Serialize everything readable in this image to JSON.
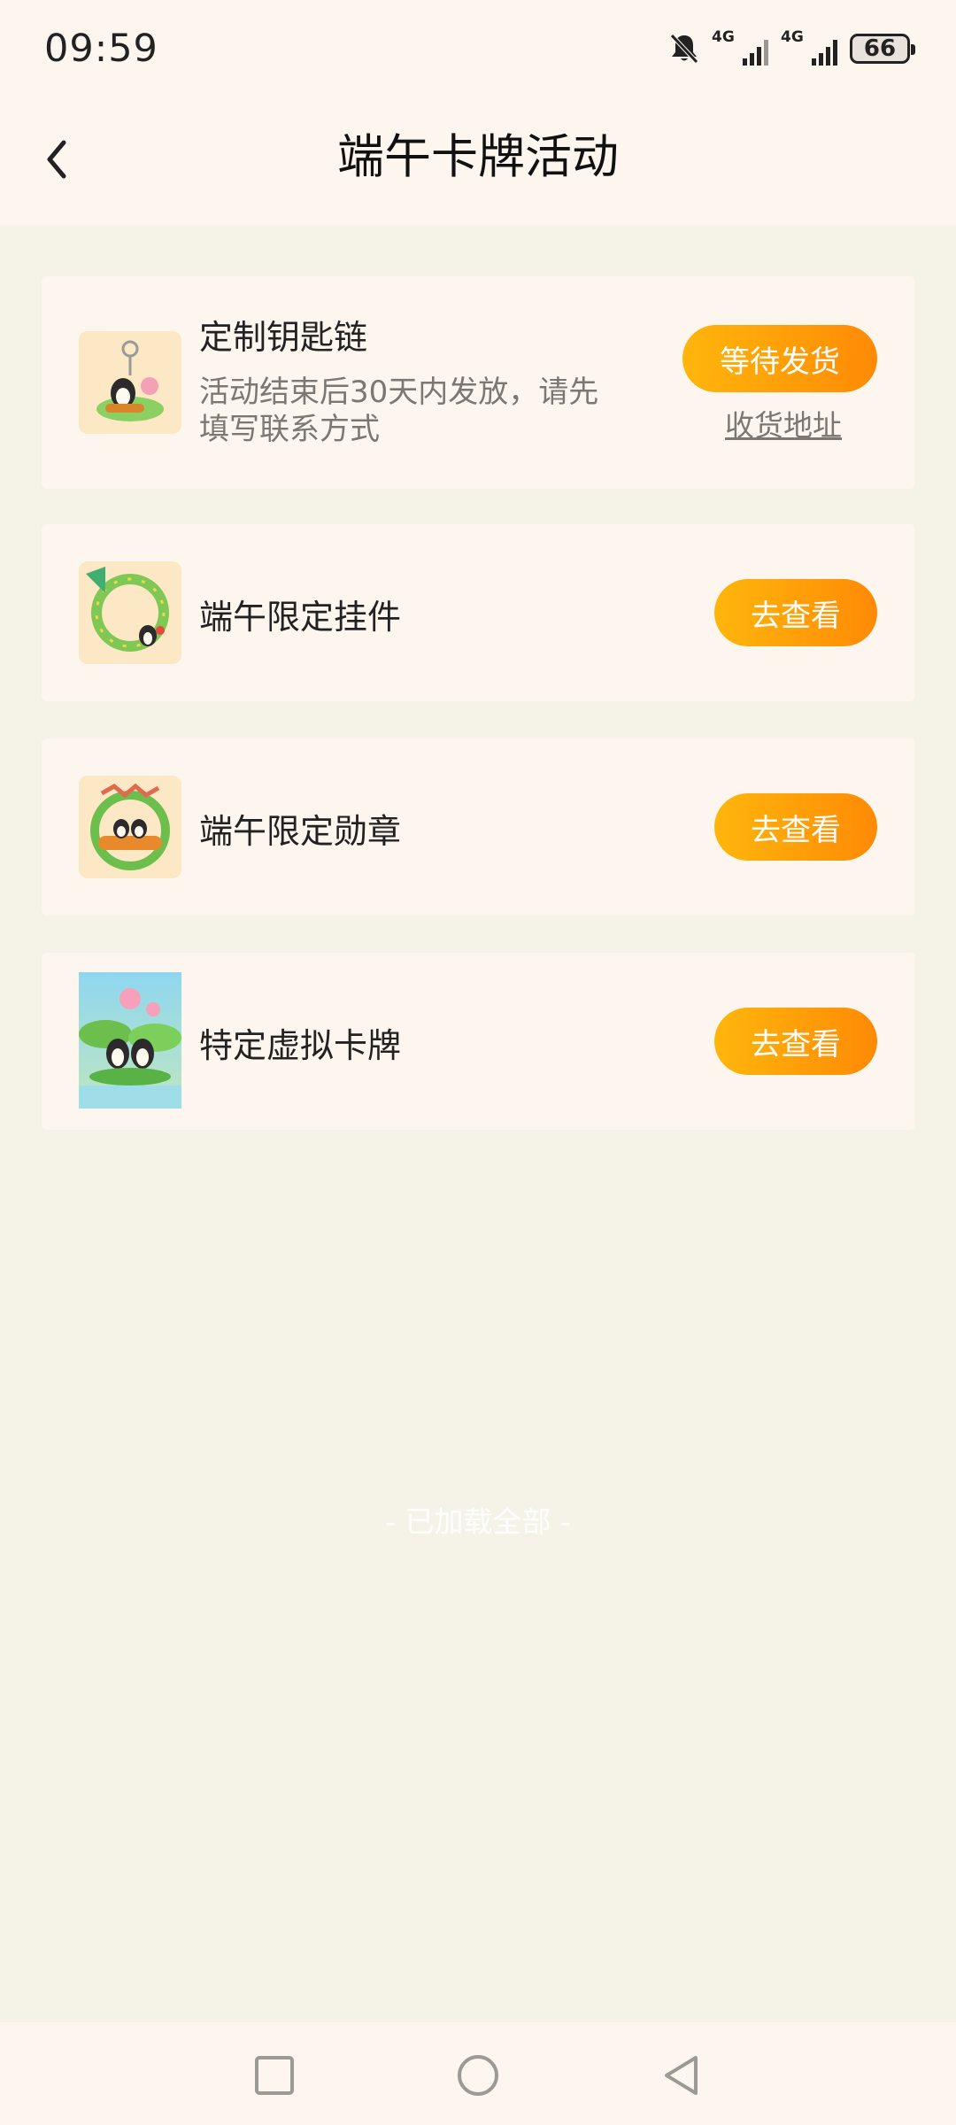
{
  "status_bar": {
    "time": "09:59",
    "sim1_label": "4G",
    "sim2_label": "4G",
    "battery": "66",
    "icons": [
      "bell-muted-icon",
      "signal-icon",
      "signal-icon",
      "battery-icon"
    ]
  },
  "header": {
    "title": "端午卡牌活动",
    "back_icon": "chevron-left-icon"
  },
  "items": [
    {
      "title": "定制钥匙链",
      "desc": "活动结束后30天内发放，请先填写联系方式",
      "button": "等待发货",
      "link": "收货地址",
      "thumb": "keychain-image"
    },
    {
      "title": "端午限定挂件",
      "button": "去查看",
      "thumb": "pendant-frame-image"
    },
    {
      "title": "端午限定勋章",
      "button": "去查看",
      "thumb": "badge-image"
    },
    {
      "title": "特定虚拟卡牌",
      "button": "去查看",
      "thumb": "virtual-card-image"
    }
  ],
  "footer": {
    "end_text": "- 已加载全部 -"
  },
  "system_nav": [
    "recents-square-icon",
    "home-circle-icon",
    "back-triangle-icon"
  ],
  "colors": {
    "page_bg": "#f5f3e8",
    "card_bg": "#fdf6ef",
    "accent_start": "#ffb60c",
    "accent_end": "#ff8a05"
  }
}
